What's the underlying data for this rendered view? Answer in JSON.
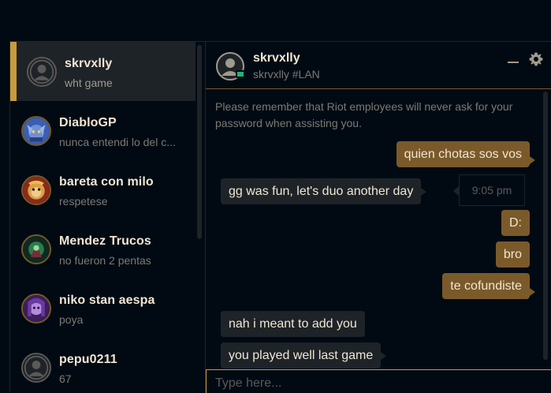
{
  "sidebar": {
    "conversations": [
      {
        "name": "skrvxlly",
        "preview": "wht game",
        "active": true,
        "avatar": "default-profile-icon"
      },
      {
        "name": "DiabloGP",
        "preview": "nunca entendi lo del c...",
        "avatar": "yordle-champion-icon"
      },
      {
        "name": "bareta con milo",
        "preview": "respetese",
        "avatar": "monkey-champion-icon"
      },
      {
        "name": "Mendez Trucos",
        "preview": "no fueron 2 pentas",
        "avatar": "green-champion-icon"
      },
      {
        "name": "niko stan aespa",
        "preview": "poya",
        "avatar": "purple-champion-icon"
      },
      {
        "name": "pepu0211",
        "preview": "67",
        "avatar": "default-profile-icon"
      }
    ]
  },
  "chat": {
    "title": "skrvxlly",
    "subtitle": "skrvxlly #LAN",
    "notice": "Please remember that Riot employees will never ask for your password when assisting you.",
    "messages": [
      {
        "text": "quien chotas sos vos",
        "dir": "out"
      },
      {
        "text": "gg was fun, let's duo another day",
        "dir": "in"
      },
      {
        "text": "D:",
        "dir": "out"
      },
      {
        "text": "bro",
        "dir": "out"
      },
      {
        "text": "te cofundiste",
        "dir": "out"
      },
      {
        "text": "nah i meant to add you",
        "dir": "in"
      },
      {
        "text": "you played well last game",
        "dir": "in"
      }
    ],
    "timestamp": "9:05 pm",
    "input_placeholder": "Type here..."
  },
  "colors": {
    "background": "#010a13",
    "accent_gold": "#c89b3c",
    "outgoing_bubble": "#7a5a2a",
    "incoming_bubble": "#1e2328",
    "online_status": "#1fb47a"
  }
}
